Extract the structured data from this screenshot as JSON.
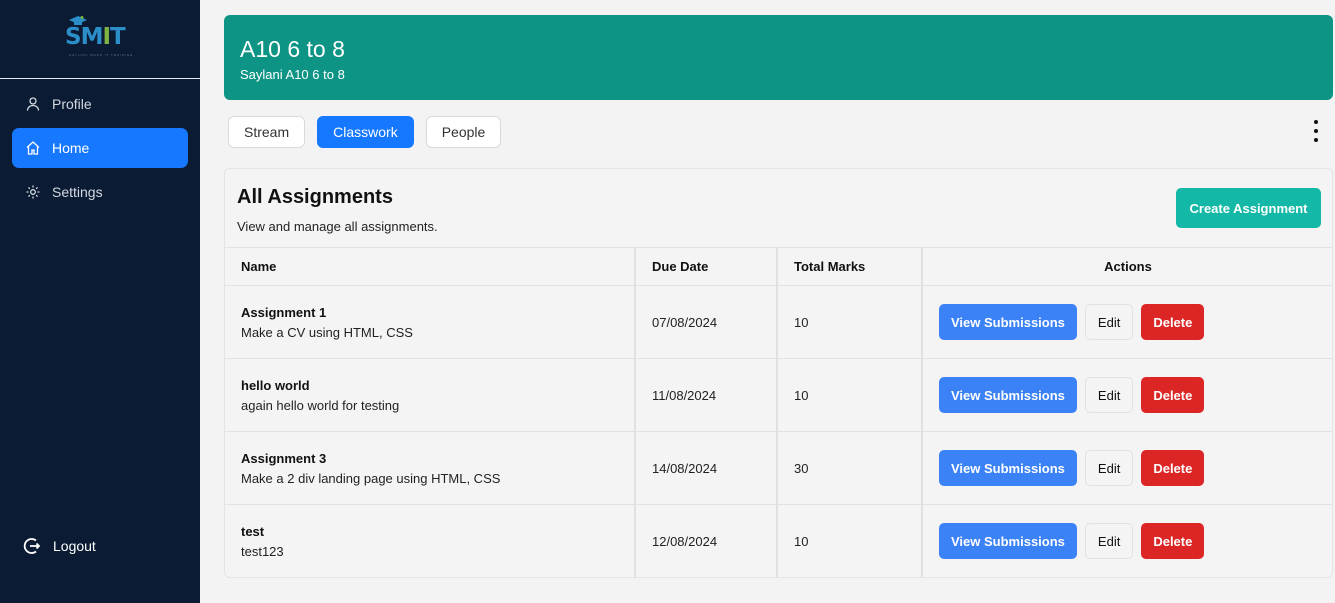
{
  "brand": {
    "logo_text": "SMIT",
    "logo_letters": [
      "S",
      "M",
      "I",
      "T"
    ],
    "logo_tagline": "SAYLANI MASS IT TRAINING"
  },
  "sidebar": {
    "items": [
      {
        "label": "Profile",
        "icon": "user-icon"
      },
      {
        "label": "Home",
        "icon": "home-icon",
        "active": true
      },
      {
        "label": "Settings",
        "icon": "gear-icon"
      }
    ],
    "logout_label": "Logout"
  },
  "banner": {
    "title": "A10 6 to 8",
    "subtitle": "Saylani A10 6 to 8",
    "color": "#0e9485"
  },
  "tabs": [
    {
      "label": "Stream"
    },
    {
      "label": "Classwork",
      "active": true
    },
    {
      "label": "People"
    }
  ],
  "assignments": {
    "title": "All Assignments",
    "subtitle": "View and manage all assignments.",
    "create_label": "Create Assignment",
    "columns": [
      "Name",
      "Due Date",
      "Total Marks",
      "Actions"
    ],
    "rows": [
      {
        "name": "Assignment 1",
        "description": "Make a CV using HTML, CSS",
        "due_date": "07/08/2024",
        "total_marks": "10"
      },
      {
        "name": "hello world",
        "description": "again hello world for testing",
        "due_date": "11/08/2024",
        "total_marks": "10"
      },
      {
        "name": "Assignment 3",
        "description": "Make a 2 div landing page using HTML, CSS",
        "due_date": "14/08/2024",
        "total_marks": "30"
      },
      {
        "name": "test",
        "description": "test123",
        "due_date": "12/08/2024",
        "total_marks": "10"
      }
    ],
    "actions": {
      "view_label": "View Submissions",
      "edit_label": "Edit",
      "delete_label": "Delete"
    }
  },
  "colors": {
    "sidebar_bg": "#0b1b34",
    "primary": "#1677ff",
    "teal": "#14b8a6",
    "danger": "#dc2626",
    "view": "#3b82f6"
  }
}
